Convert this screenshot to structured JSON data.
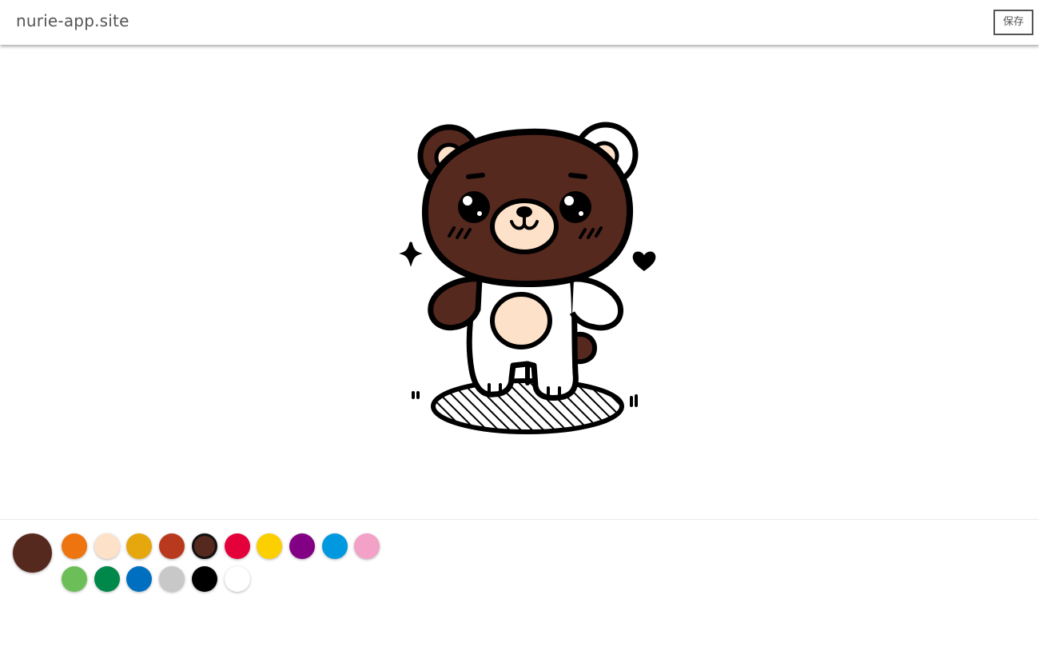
{
  "header": {
    "site_title": "nurie-app.site",
    "save_label": "保存"
  },
  "canvas": {
    "subject": "bear",
    "fills": {
      "head": "#56291f",
      "left_ear_outer": "#56291f",
      "left_ear_inner": "#fde2c9",
      "right_ear_outer": "#ffffff",
      "right_ear_inner": "#fde2c9",
      "muzzle": "#fde2c9",
      "belly": "#fde2c9",
      "body": "#ffffff",
      "left_arm": "#56291f",
      "right_arm": "#ffffff",
      "tail": "#56291f",
      "shadow": "#ffffff"
    }
  },
  "palette": {
    "current_color": "#56291f",
    "selected_index": 4,
    "row1": [
      "#ee7410",
      "#fde2c9",
      "#e6a60e",
      "#b9391e",
      "#56291f",
      "#e4003a",
      "#fccf00",
      "#820084",
      "#0099e0",
      "#f3a1c7"
    ],
    "row2": [
      "#6cbf58",
      "#00874a",
      "#006fc0",
      "#c8c8c8",
      "#000000",
      "#ffffff"
    ]
  }
}
